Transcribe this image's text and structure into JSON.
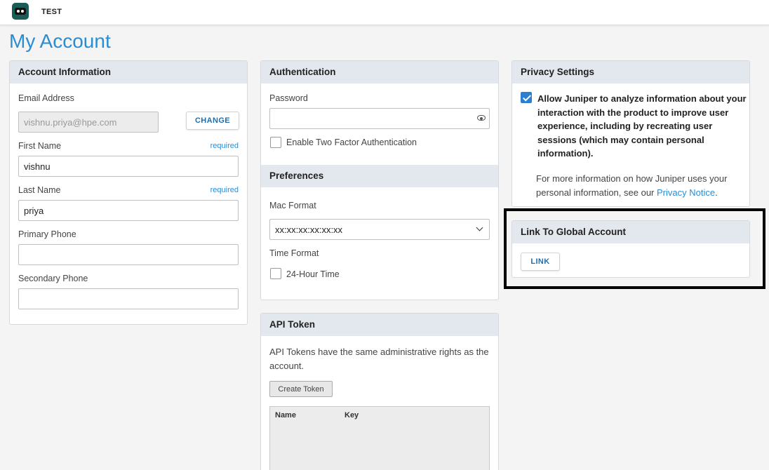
{
  "app": {
    "org_name": "TEST",
    "logo_icon": "robot-logo-icon"
  },
  "page_title": "My Account",
  "account_info": {
    "header": "Account Information",
    "email_label": "Email Address",
    "email_value": "vishnu.priya@hpe.com",
    "change_button": "CHANGE",
    "first_name_label": "First Name",
    "first_name_required": "required",
    "first_name_value": "vishnu",
    "last_name_label": "Last Name",
    "last_name_required": "required",
    "last_name_value": "priya",
    "primary_phone_label": "Primary Phone",
    "primary_phone_value": "",
    "secondary_phone_label": "Secondary Phone",
    "secondary_phone_value": ""
  },
  "authentication": {
    "header": "Authentication",
    "password_label": "Password",
    "password_value": "",
    "two_factor_label": "Enable Two Factor Authentication",
    "two_factor_checked": false
  },
  "preferences": {
    "header": "Preferences",
    "mac_format_label": "Mac Format",
    "mac_format_value": "xx:xx:xx:xx:xx:xx",
    "time_format_label": "Time Format",
    "time_24h_label": "24-Hour Time",
    "time_24h_checked": false
  },
  "api_token": {
    "header": "API Token",
    "description": "API Tokens have the same administrative rights as the account.",
    "create_button": "Create Token",
    "columns": [
      "Name",
      "Key"
    ],
    "rows": []
  },
  "privacy": {
    "header": "Privacy Settings",
    "consent_checked": true,
    "consent_text": "Allow Juniper to analyze information about your interaction with the product to improve user experience, including by recreating user sessions (which may contain personal information).",
    "info_text": "For more information on how Juniper uses your personal information, see our ",
    "notice_link": "Privacy Notice",
    "info_end": "."
  },
  "global_account": {
    "header": "Link To Global Account",
    "link_button": "LINK"
  },
  "colors": {
    "accent": "#2a8dd4",
    "header_bg": "#e3e8ef",
    "checkbox_checked": "#2a7fd0"
  }
}
